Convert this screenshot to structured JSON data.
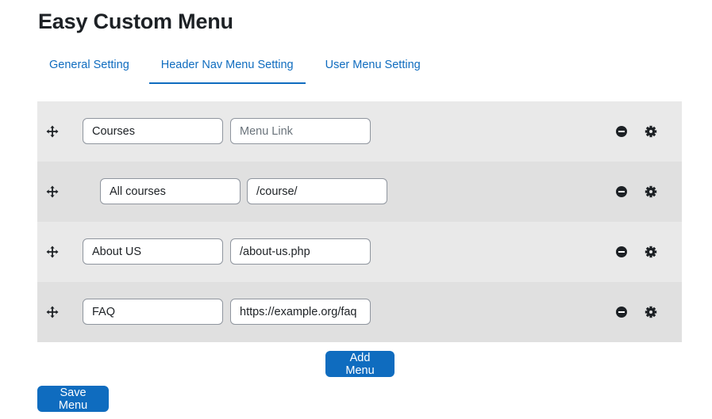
{
  "page": {
    "title": "Easy Custom Menu"
  },
  "tabs": [
    {
      "label": "General Setting",
      "active": false
    },
    {
      "label": "Header Nav Menu Setting",
      "active": true
    },
    {
      "label": "User Menu Setting",
      "active": false
    }
  ],
  "menu_items": [
    {
      "name": "Courses",
      "link": "",
      "link_placeholder": "Menu Link",
      "level": 0
    },
    {
      "name": "All courses",
      "link": "/course/",
      "link_placeholder": "",
      "level": 1
    },
    {
      "name": "About US",
      "link": "/about-us.php",
      "link_placeholder": "",
      "level": 0
    },
    {
      "name": "FAQ",
      "link": "https://example.org/faq",
      "link_placeholder": "",
      "level": 0
    }
  ],
  "icons": {
    "drag": "move-arrows-icon",
    "remove": "minus-circle-icon",
    "settings": "gear-icon"
  },
  "buttons": {
    "add_menu": "Add Menu",
    "save_menu": "Save Menu"
  },
  "colors": {
    "accent": "#0f6cbf",
    "row_odd": "#e9e9e9",
    "row_even": "#e0e0e0",
    "title": "#1d2125"
  }
}
